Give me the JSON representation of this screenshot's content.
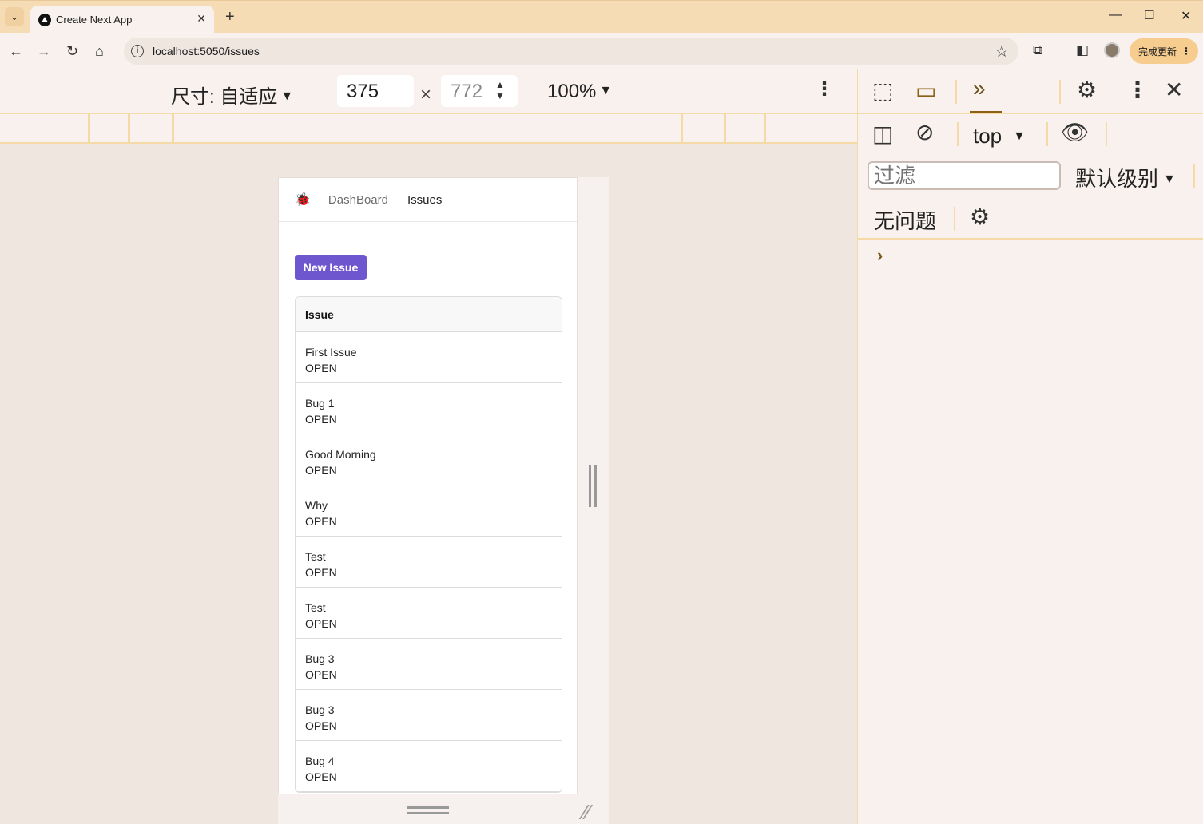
{
  "browser": {
    "tab_title": "Create Next App",
    "url": "localhost:5050/issues",
    "update_label": "完成更新"
  },
  "device_toolbar": {
    "size_label": "尺寸: 自适应",
    "width": "375",
    "height": "772",
    "zoom": "100%"
  },
  "app": {
    "nav": {
      "dashboard": "DashBoard",
      "issues": "Issues"
    },
    "new_issue_label": "New Issue",
    "table_header": "Issue",
    "issues": [
      {
        "title": "First Issue",
        "status": "OPEN"
      },
      {
        "title": "Bug 1",
        "status": "OPEN"
      },
      {
        "title": "Good Morning",
        "status": "OPEN"
      },
      {
        "title": "Why",
        "status": "OPEN"
      },
      {
        "title": "Test",
        "status": "OPEN"
      },
      {
        "title": "Test",
        "status": "OPEN"
      },
      {
        "title": "Bug 3",
        "status": "OPEN"
      },
      {
        "title": "Bug 3",
        "status": "OPEN"
      },
      {
        "title": "Bug 4",
        "status": "OPEN"
      }
    ]
  },
  "devtools": {
    "context": "top",
    "filter_placeholder": "过滤",
    "level_label": "默认级别",
    "issues_label": "无问题"
  },
  "colors": {
    "accent": "#6e56cf",
    "tabstrip": "#f5dcb4",
    "ruler_line": "#f5d9a6"
  }
}
